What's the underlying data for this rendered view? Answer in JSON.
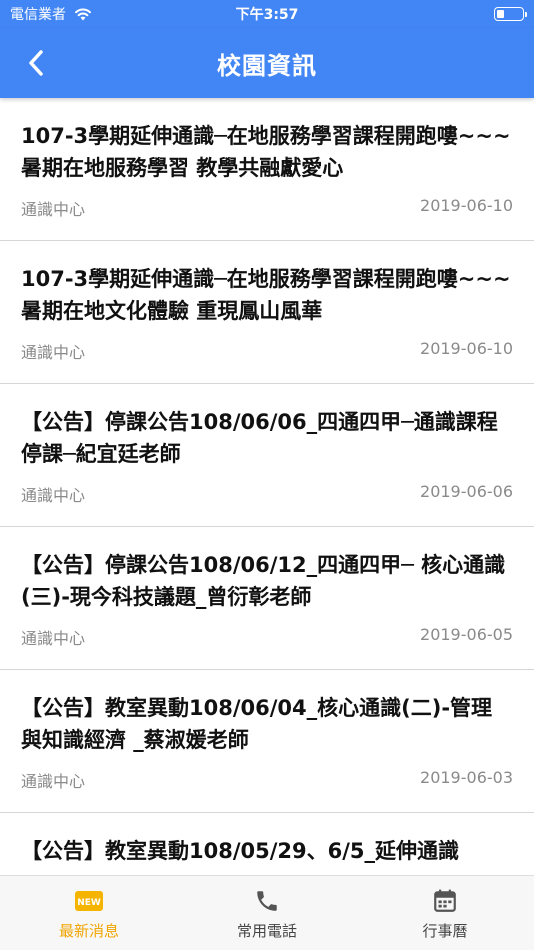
{
  "status_bar": {
    "carrier": "電信業者",
    "time": "下午3:57",
    "battery_level": 0.25
  },
  "header": {
    "title": "校園資訊",
    "background_color": "#4285f4"
  },
  "news": [
    {
      "title": "107-3學期延伸通識─在地服務學習課程開跑嘍~~~ 暑期在地服務學習 教學共融獻愛心",
      "source": "通識中心",
      "date": "2019-06-10"
    },
    {
      "title": "107-3學期延伸通識─在地服務學習課程開跑嘍~~~ 暑期在地文化體驗 重現鳳山風華",
      "source": "通識中心",
      "date": "2019-06-10"
    },
    {
      "title": "【公告】停課公告108/06/06_四通四甲─通識課程停課─紀宜廷老師",
      "source": "通識中心",
      "date": "2019-06-06"
    },
    {
      "title": "【公告】停課公告108/06/12_四通四甲─ 核心通識(三)-現今科技議題_曾衍彰老師",
      "source": "通識中心",
      "date": "2019-06-05"
    },
    {
      "title": "【公告】教室異動108/06/04_核心通識(二)-管理與知識經濟 _蔡淑媛老師",
      "source": "通識中心",
      "date": "2019-06-03"
    },
    {
      "title": "【公告】教室異動108/05/29、6/5_延伸通識",
      "source": "",
      "date": ""
    }
  ],
  "tabs": [
    {
      "label": "最新消息",
      "icon": "new-badge-icon",
      "active": true
    },
    {
      "label": "常用電話",
      "icon": "phone-icon",
      "active": false
    },
    {
      "label": "行事曆",
      "icon": "calendar-icon",
      "active": false
    }
  ],
  "colors": {
    "accent": "#f0a500",
    "tab_inactive": "#444444"
  }
}
